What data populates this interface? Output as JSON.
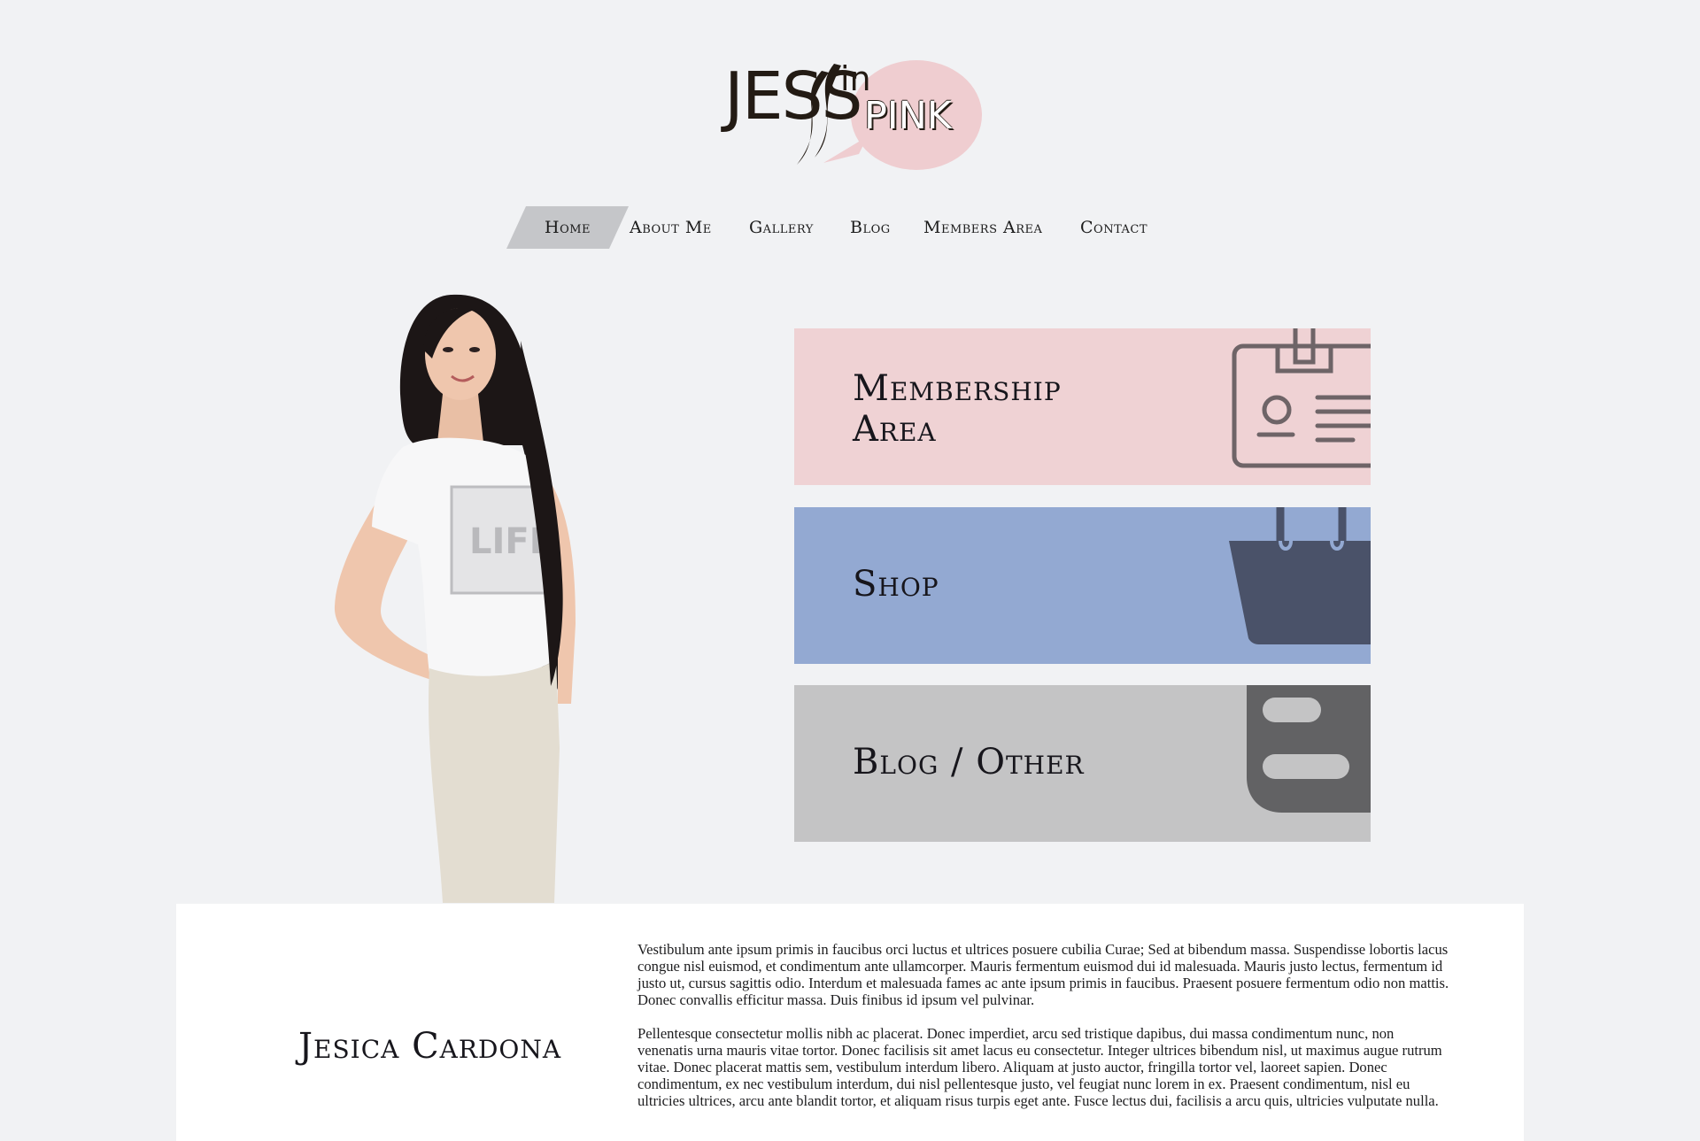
{
  "logo": {
    "jess": "JESS",
    "in": "in",
    "pink": "PINK"
  },
  "nav": {
    "items": [
      {
        "label": "Home",
        "active": true
      },
      {
        "label": "About Me",
        "active": false
      },
      {
        "label": "Gallery",
        "active": false
      },
      {
        "label": "Blog",
        "active": false
      },
      {
        "label": "Members Area",
        "active": false
      },
      {
        "label": "Contact",
        "active": false
      }
    ]
  },
  "cards": [
    {
      "title_line1": "Membership",
      "title_line2": "Area",
      "icon": "id-badge-icon",
      "color": "#efd2d4"
    },
    {
      "title": "Shop",
      "icon": "shopping-bag-icon",
      "color": "#93a9d2"
    },
    {
      "title": "Blog / Other",
      "icon": "blogger-icon",
      "color": "#c4c4c5"
    }
  ],
  "bio": {
    "name": "Jesica Cardona",
    "paragraphs": [
      "Vestibulum ante ipsum primis in faucibus orci luctus et ultrices posuere cubilia Curae; Sed at bibendum massa. Suspendisse lobortis lacus congue nisl euismod, et condimentum ante ullamcorper. Mauris fermentum euismod dui id malesuada. Mauris justo lectus, fermentum id justo ut, cursus sagittis odio. Interdum et malesuada fames ac ante ipsum primis in faucibus. Praesent posuere fermentum odio non mattis. Donec convallis efficitur massa. Duis finibus id ipsum vel pulvinar.",
      "Pellentesque consectetur mollis nibh ac placerat. Donec imperdiet, arcu sed tristique dapibus, dui massa condimentum nunc, non venenatis urna mauris vitae tortor. Donec facilisis sit amet lacus eu consectetur. Integer ultrices bibendum nisl, ut maximus augue rutrum vitae. Donec placerat mattis sem, vestibulum interdum libero. Aliquam at justo auctor, fringilla tortor vel, laoreet sapien. Donec condimentum, ex nec vestibulum interdum, dui nisl pellentesque justo, vel feugiat nunc lorem in ex. Praesent condimentum, nisl eu ultricies ultrices, arcu ante blandit tortor, et aliquam risus turpis eget ante. Fusce lectus dui, facilisis a arcu quis, ultricies vulputate nulla."
    ]
  },
  "colors": {
    "background": "#f1f2f4",
    "pink": "#efd2d4",
    "blue": "#93a9d2",
    "grey": "#c4c4c5",
    "icon_dark": "#4a5269",
    "text": "#17161c"
  }
}
